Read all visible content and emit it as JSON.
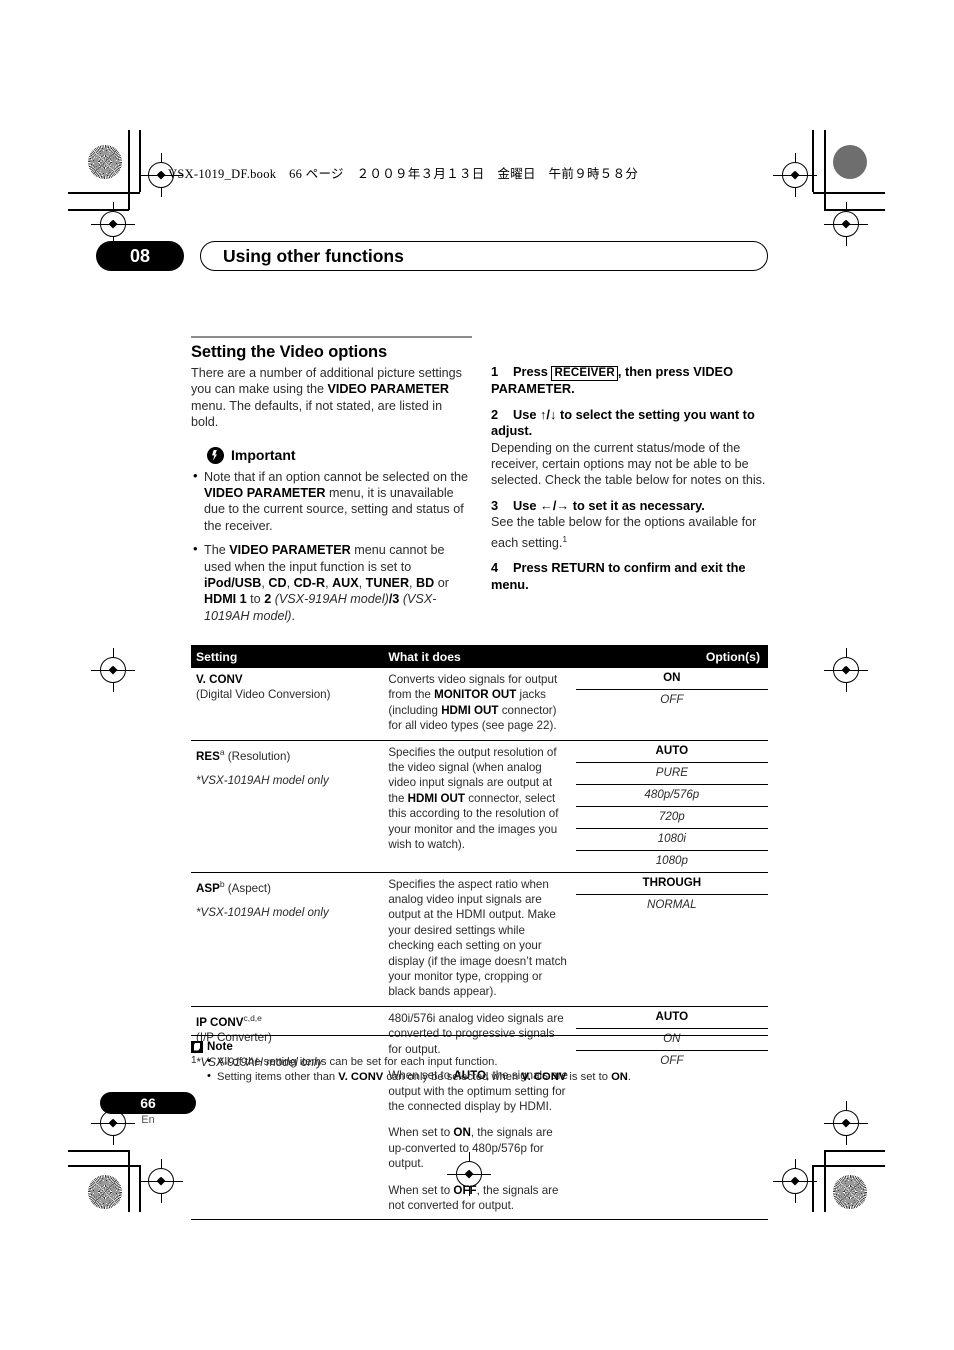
{
  "print_header": "VSX-1019_DF.book　66 ページ　２００９年３月１３日　金曜日　午前９時５８分",
  "chapter": {
    "number": "08",
    "title": "Using other functions"
  },
  "left_column": {
    "section_title": "Setting the Video options",
    "intro_parts": [
      {
        "t": "There are a number of additional picture settings you can make using the ",
        "b": false
      },
      {
        "t": "VIDEO PARAMETER",
        "b": true
      },
      {
        "t": " menu. The defaults, if not stated, are listed in bold.",
        "b": false
      }
    ],
    "important_label": "Important",
    "important_icon": "exclamation-circle-icon",
    "important_bullets": [
      [
        {
          "t": "Note that if an option cannot be selected on the ",
          "b": false
        },
        {
          "t": "VIDEO PARAMETER",
          "b": true
        },
        {
          "t": " menu, it is unavailable due to the current source, setting and status of the receiver.",
          "b": false
        }
      ],
      [
        {
          "t": "The ",
          "b": false
        },
        {
          "t": "VIDEO PARAMETER",
          "b": true
        },
        {
          "t": " menu cannot be used when the input function is set to ",
          "b": false
        },
        {
          "t": "iPod/USB",
          "b": true
        },
        {
          "t": ", ",
          "b": false
        },
        {
          "t": "CD",
          "b": true
        },
        {
          "t": ", ",
          "b": false
        },
        {
          "t": "CD-R",
          "b": true
        },
        {
          "t": ", ",
          "b": false
        },
        {
          "t": "AUX",
          "b": true
        },
        {
          "t": ", ",
          "b": false
        },
        {
          "t": "TUNER",
          "b": true
        },
        {
          "t": ", ",
          "b": false
        },
        {
          "t": "BD",
          "b": true
        },
        {
          "t": " or ",
          "b": false
        },
        {
          "t": "HDMI 1",
          "b": true
        },
        {
          "t": " to ",
          "b": false
        },
        {
          "t": "2",
          "b": true
        },
        {
          "t": " (VSX-919AH model)",
          "b": false,
          "i": true
        },
        {
          "t": "/3",
          "b": true
        },
        {
          "t": " (VSX-1019AH model)",
          "b": false,
          "i": true
        },
        {
          "t": ".",
          "b": false
        }
      ]
    ]
  },
  "right_column": {
    "steps": [
      {
        "number": "1",
        "head_parts": [
          {
            "t": "Press ",
            "b": true
          },
          {
            "t": "RECEIVER",
            "key": true
          },
          {
            "t": ", then press VIDEO PARAMETER.",
            "b": true
          }
        ],
        "body": ""
      },
      {
        "number": "2",
        "head_parts": [
          {
            "t": "Use ",
            "b": true
          },
          {
            "t": "↑/↓",
            "b": true
          },
          {
            "t": " to select the setting you want to adjust.",
            "b": true
          }
        ],
        "body": "Depending on the current status/mode of the receiver, certain options may not be able to be selected. Check the table below for notes on this."
      },
      {
        "number": "3",
        "head_parts": [
          {
            "t": "Use ",
            "b": true
          },
          {
            "t": "←/→",
            "b": true
          },
          {
            "t": " to set it as necessary.",
            "b": true
          }
        ],
        "body": "See the table below for the options available for each setting.",
        "body_sup": "1"
      },
      {
        "number": "4",
        "head_parts": [
          {
            "t": "Press RETURN to confirm and exit the menu.",
            "b": true
          }
        ],
        "body": ""
      }
    ]
  },
  "table": {
    "headers": {
      "setting": "Setting",
      "what": "What it does",
      "options": "Option(s)"
    },
    "rows": [
      {
        "setting_parts": [
          {
            "t": "V. CONV",
            "b": true
          },
          {
            "t": "\n(Digital Video Conversion)",
            "b": false
          }
        ],
        "setting_name": "V. CONV",
        "setting_sub": "(Digital Video Conversion)",
        "setting_sup": "",
        "model_note": "",
        "what_paragraphs": [
          [
            {
              "t": "Converts video signals for output from the ",
              "b": false
            },
            {
              "t": "MONITOR OUT",
              "b": true
            },
            {
              "t": " jacks (including ",
              "b": false
            },
            {
              "t": "HDMI OUT",
              "b": true
            },
            {
              "t": " connector) for all video types (see page 22).",
              "b": false
            }
          ]
        ],
        "options": [
          {
            "label": "ON",
            "default": true
          },
          {
            "label": "OFF",
            "default": false
          }
        ]
      },
      {
        "setting_name": "RES",
        "setting_sup": "a",
        "setting_sub": "(Resolution)",
        "setting_sub_inline": true,
        "model_note": "*VSX-1019AH model only",
        "what_paragraphs": [
          [
            {
              "t": "Specifies the output resolution of the video signal (when analog video input signals are output at the ",
              "b": false
            },
            {
              "t": "HDMI OUT",
              "b": true
            },
            {
              "t": " connector, select this according to the resolution of your monitor and the images you wish to watch).",
              "b": false
            }
          ]
        ],
        "options": [
          {
            "label": "AUTO",
            "default": true
          },
          {
            "label": "PURE",
            "default": false
          },
          {
            "label": "480p/576p",
            "default": false
          },
          {
            "label": "720p",
            "default": false
          },
          {
            "label": "1080i",
            "default": false
          },
          {
            "label": "1080p",
            "default": false
          }
        ]
      },
      {
        "setting_name": "ASP",
        "setting_sup": "b",
        "setting_sub": "(Aspect)",
        "setting_sub_inline": true,
        "model_note": "*VSX-1019AH model only",
        "what_paragraphs": [
          [
            {
              "t": "Specifies the aspect ratio when analog video input signals are output at the HDMI output. Make your desired settings while checking each setting on your display (if the image doesn’t match your monitor type, cropping or black bands appear).",
              "b": false
            }
          ]
        ],
        "options": [
          {
            "label": "THROUGH",
            "default": true
          },
          {
            "label": "NORMAL",
            "default": false
          }
        ]
      },
      {
        "setting_name": "IP  CONV",
        "setting_sup": "c,d,e",
        "setting_sub": "(I/P Converter)",
        "setting_sub_inline": false,
        "model_note": "*VSX-919AH model only",
        "what_paragraphs": [
          [
            {
              "t": "480i/576i analog video signals are converted to progressive signals for output.",
              "b": false
            }
          ],
          [
            {
              "t": "When set to ",
              "b": false
            },
            {
              "t": "AUTO",
              "b": true
            },
            {
              "t": ", the signals are output with the optimum setting for the connected display by HDMI.",
              "b": false
            }
          ],
          [
            {
              "t": "When set to ",
              "b": false
            },
            {
              "t": "ON",
              "b": true
            },
            {
              "t": ", the signals are up-converted to 480p/576p for output.",
              "b": false
            }
          ],
          [
            {
              "t": "When set to ",
              "b": false
            },
            {
              "t": "OFF",
              "b": true
            },
            {
              "t": ", the signals are not converted for output.",
              "b": false
            }
          ]
        ],
        "options": [
          {
            "label": "AUTO",
            "default": true
          },
          {
            "label": "ON",
            "default": false
          },
          {
            "label": "OFF",
            "default": false
          }
        ]
      }
    ]
  },
  "note": {
    "icon": "note-icon",
    "title": "Note",
    "index": "1",
    "items": [
      [
        {
          "t": "All of the setting items can be set for each input function.",
          "b": false
        }
      ],
      [
        {
          "t": "Setting items other than ",
          "b": false
        },
        {
          "t": "V. CONV",
          "b": true
        },
        {
          "t": " can only be selected when ",
          "b": false
        },
        {
          "t": "V. CONV",
          "b": true
        },
        {
          "t": " is set to ",
          "b": false
        },
        {
          "t": "ON",
          "b": true
        },
        {
          "t": ".",
          "b": false
        }
      ]
    ]
  },
  "footer": {
    "page_number": "66",
    "language": "En"
  }
}
